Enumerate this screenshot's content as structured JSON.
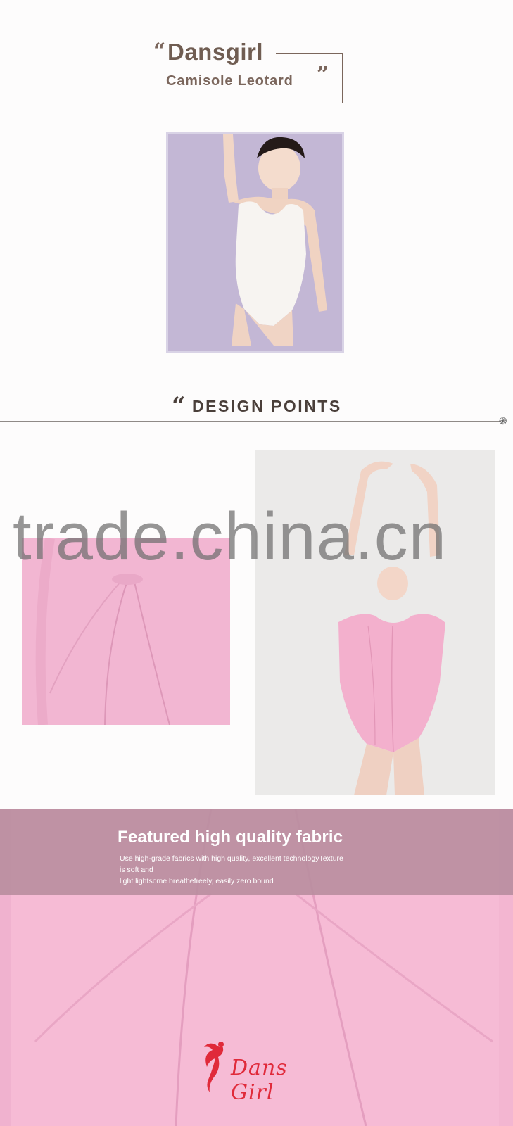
{
  "header": {
    "quote_open": "“",
    "brand": "Dansgirl",
    "subtitle": "Camisole Leotard",
    "quote_close": "”"
  },
  "design_points": {
    "quote": "“",
    "title": "DESIGN POINTS"
  },
  "watermark": "trade.china.cn",
  "fabric": {
    "headline": "Featured high quality fabric",
    "desc_line1": "Use high-grade fabrics with high quality,  excellent technologyTexture",
    "desc_line2": "is soft and",
    "desc_line3": "light lightsome breathefreely, easily zero bound"
  },
  "logo": {
    "text": "Dans Girl"
  },
  "colors": {
    "title_brown": "#705d52",
    "hero_background": "#c1b5d3",
    "leotard_pink": "#f6bad5",
    "banner_mauve": "#ba8ea0",
    "logo_red": "#e02a3a"
  }
}
